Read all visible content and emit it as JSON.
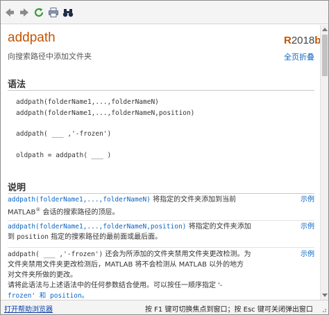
{
  "toolbar": {
    "buttons": [
      {
        "icon": "back-arrow-icon",
        "color": "#8a8a8a"
      },
      {
        "icon": "forward-arrow-icon",
        "color": "#8a8a8a"
      },
      {
        "icon": "refresh-icon",
        "color": "#3a9a3a"
      },
      {
        "icon": "print-icon",
        "color": "#5b6b86"
      },
      {
        "icon": "find-binoculars-icon",
        "color": "#1d2a44"
      }
    ]
  },
  "header": {
    "title": "addpath",
    "release_r": "R",
    "release_year": "2018",
    "release_b": "b",
    "subtitle": "向搜索路径中添加文件夹",
    "collapse_all": "全页折叠"
  },
  "syntax": {
    "heading": "语法",
    "lines": [
      "addpath(folderName1,...,folderNameN)",
      "addpath(folderName1,...,folderNameN,position)",
      "addpath( ___ ,'-frozen')",
      "oldpath = addpath( ___ )"
    ]
  },
  "description": {
    "heading": "说明",
    "example_label": "示例",
    "rows": [
      {
        "code": "addpath(folderName1,...,folderNameN)",
        "text1": " 将指定的文件夹添加到当前",
        "text2a": "MATLAB",
        "text2sup": "®",
        "text2b": " 会话的搜索路径的顶层。"
      },
      {
        "code": "addpath(folderName1,...,folderNameN,position)",
        "text1": " 将指定的文件夹添加",
        "text2a": "到 ",
        "text2code": "position",
        "text2b": " 指定的搜索路径的最前面或最后面。"
      },
      {
        "code": "addpath( ___ ,'-frozen')",
        "text1": " 还会为所添加的文件夹禁用文件夹更改检测。为",
        "text2": "文件夹禁用文件夹更改检测后，MATLAB 将不会检测从 MATLAB 以外的地方",
        "text3": "对文件夹所做的更改。",
        "text4": "请将此语法与上述语法中的任何参数结合使用。可以按任一顺序指定 '-",
        "text5": "frozen' 和 position。"
      }
    ]
  },
  "statusbar": {
    "link": "打开帮助浏览器",
    "hint": "按 F1 键可切换焦点到窗口；按 Esc 键可关闭弹出窗口"
  }
}
